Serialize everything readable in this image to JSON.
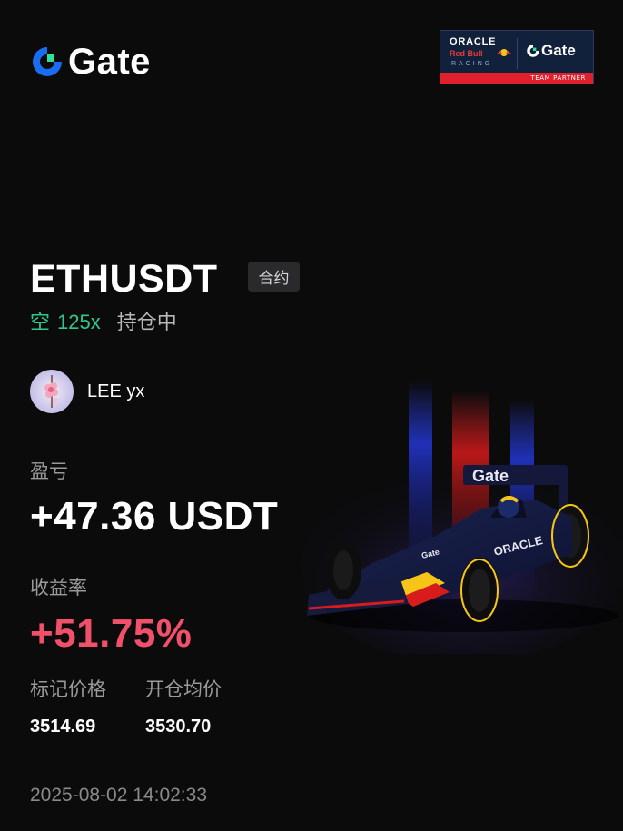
{
  "brand": {
    "name": "Gate"
  },
  "partner": {
    "oracle": "ORACLE",
    "redbull": "Red Bull",
    "racing": "RACING",
    "gate": "Gate",
    "badge": "TEAM PARTNER"
  },
  "position": {
    "pair": "ETHUSDT",
    "type_tag": "合约",
    "direction": "空",
    "leverage": "125x",
    "status": "持仓中"
  },
  "user": {
    "name": "LEE yx"
  },
  "pnl": {
    "label": "盈亏",
    "value": "+47.36 USDT"
  },
  "roi": {
    "label": "收益率",
    "value": "+51.75%"
  },
  "prices": {
    "mark_label": "标记价格",
    "mark_value": "3514.69",
    "entry_label": "开仓均价",
    "entry_value": "3530.70"
  },
  "timestamp": "2025-08-02 14:02:33",
  "colors": {
    "background": "#0b0b0c",
    "short_green": "#2fc88b",
    "roi_red": "#f0506a",
    "brand_blue": "#1a6cf0",
    "brand_green": "#2fe09a"
  },
  "icons": {
    "logo": "gate-logo-icon",
    "avatar": "peach-blossom-avatar",
    "car": "f1-racing-car-image"
  }
}
